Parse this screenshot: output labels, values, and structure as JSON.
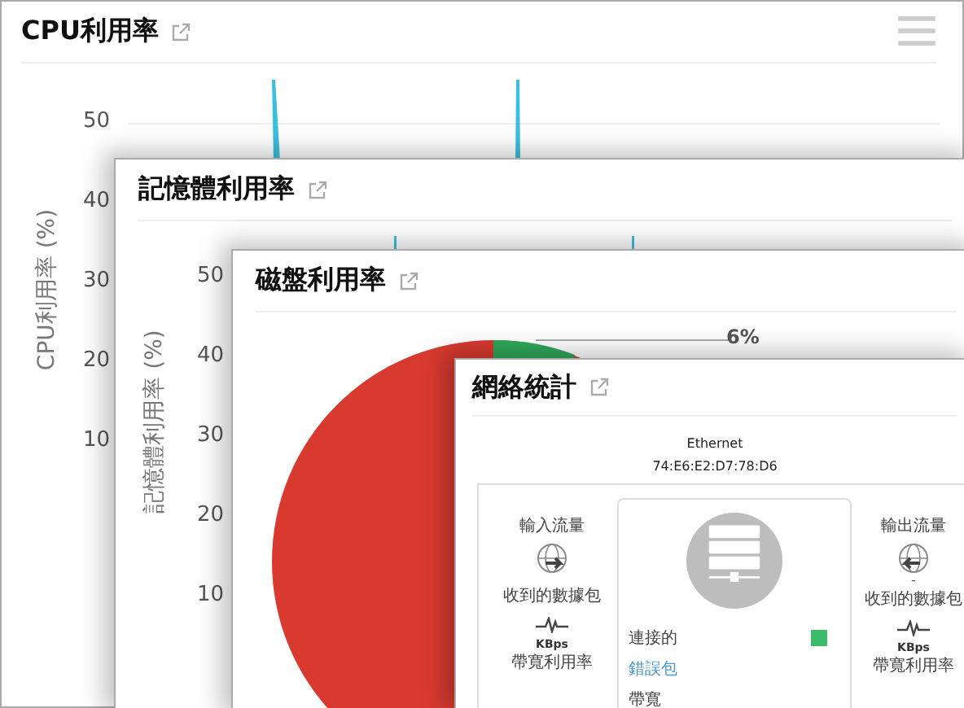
{
  "cpu_panel": {
    "title": "CPU利用率",
    "y_axis_title": "CPU利用率 (%)",
    "y_ticks": [
      "50",
      "40",
      "30",
      "20",
      "10"
    ]
  },
  "memory_panel": {
    "title": "記憶體利用率",
    "y_axis_title": "記憶體利用率 (%)",
    "y_ticks": [
      "50",
      "40",
      "30",
      "20",
      "10"
    ]
  },
  "disk_panel": {
    "title": "磁盤利用率",
    "slice_label": "6%"
  },
  "network_panel": {
    "title": "網絡統計",
    "interface": "Ethernet",
    "mac": "74:E6:E2:D7:78:D6",
    "inbound": {
      "heading": "輸入流量",
      "packets": "收到的數據包",
      "unit": "KBps",
      "bandwidth": "帶寬利用率"
    },
    "outbound": {
      "heading": "輸出流量",
      "value": "-",
      "packets": "收到的數據包",
      "unit": "KBps",
      "bandwidth": "帶寬利用率"
    },
    "status": {
      "label": "連接的",
      "connected": true
    },
    "error_link": "錯誤包",
    "bandwidth_label": "帶寬"
  }
}
